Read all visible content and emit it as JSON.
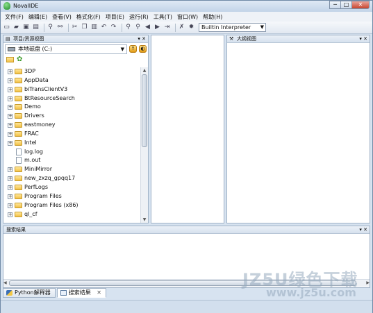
{
  "window": {
    "title": "NovalIDE",
    "minimize": "─",
    "maximize": "□",
    "close": "✕"
  },
  "menubar": {
    "items": [
      "文件(F)",
      "编辑(E)",
      "查看(V)",
      "格式化(F)",
      "项目(E)",
      "运行(R)",
      "工具(T)",
      "窗口(W)",
      "帮助(H)"
    ]
  },
  "toolbar": {
    "interpreter": "Builtin Interpreter"
  },
  "project_panel": {
    "title": "项目/资源视图",
    "drive": "本地磁盘 (C:)",
    "tree": [
      {
        "label": "3DP",
        "type": "folder"
      },
      {
        "label": "AppData",
        "type": "folder"
      },
      {
        "label": "biTransClientV3",
        "type": "folder"
      },
      {
        "label": "BtResourceSearch",
        "type": "folder"
      },
      {
        "label": "Demo",
        "type": "folder"
      },
      {
        "label": "Drivers",
        "type": "folder"
      },
      {
        "label": "eastmoney",
        "type": "folder"
      },
      {
        "label": "FRAC",
        "type": "folder"
      },
      {
        "label": "Intel",
        "type": "folder"
      },
      {
        "label": "log.log",
        "type": "file"
      },
      {
        "label": "m.out",
        "type": "file"
      },
      {
        "label": "MiniMirror",
        "type": "folder"
      },
      {
        "label": "new_zxzq_gpqq17",
        "type": "folder"
      },
      {
        "label": "PerfLogs",
        "type": "folder"
      },
      {
        "label": "Program Files",
        "type": "folder"
      },
      {
        "label": "Program Files (x86)",
        "type": "folder"
      },
      {
        "label": "ql_cf",
        "type": "folder"
      }
    ]
  },
  "outline_panel": {
    "title": "大纲视图"
  },
  "search_panel": {
    "title": "搜索结果"
  },
  "bottom_tabs": [
    {
      "label": "Python解释器",
      "active": false
    },
    {
      "label": "搜索结果",
      "active": true
    }
  ],
  "watermark": {
    "line1": "JZ5U绿色下载",
    "line2": "www.jz5u.com"
  }
}
